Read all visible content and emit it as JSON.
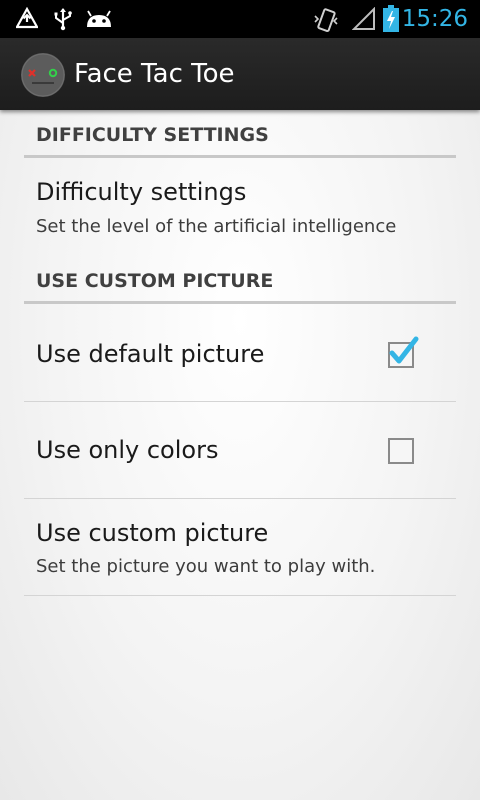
{
  "status_bar": {
    "time": "15:26",
    "time_color": "#33b5e5",
    "icons": [
      "upload-warning-icon",
      "usb-icon",
      "android-icon",
      "vibrate-icon",
      "signal-icon",
      "battery-charging-icon"
    ]
  },
  "action_bar": {
    "title": "Face Tac Toe",
    "app_icon": "face-tac-toe-app-icon"
  },
  "categories": [
    {
      "label": "DIFFICULTY SETTINGS",
      "prefs": [
        {
          "title": "Difficulty settings",
          "summary": "Set the level of the artificial intelligence"
        }
      ]
    },
    {
      "label": "USE CUSTOM PICTURE",
      "prefs": [
        {
          "title": "Use default picture",
          "checked": true
        },
        {
          "title": "Use only colors",
          "checked": false
        },
        {
          "title": "Use custom picture",
          "summary": "Set the picture you want to play with."
        }
      ]
    }
  ],
  "colors": {
    "accent": "#33b5e5",
    "action_bar": "#222222",
    "divider": "#c8c8c8"
  }
}
